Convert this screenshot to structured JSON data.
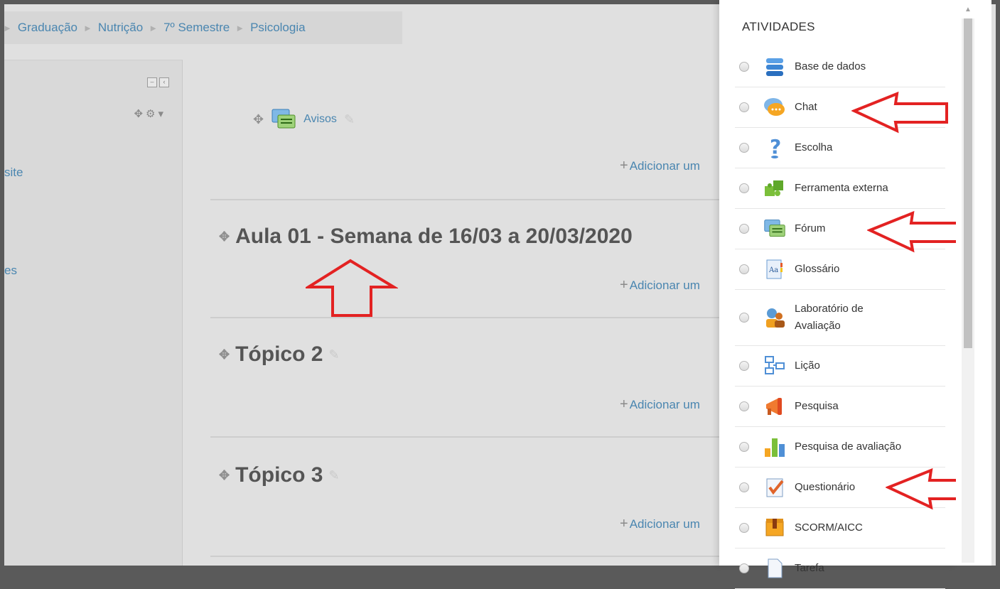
{
  "breadcrumb": {
    "items": [
      "Graduação",
      "Nutrição",
      "7º Semestre",
      "Psicologia"
    ]
  },
  "leftblock": {
    "links": [
      "site",
      "es"
    ]
  },
  "main": {
    "avisos_label": "Avisos",
    "add_label": "Adicionar um",
    "sections": [
      {
        "title": "Aula 01 - Semana de 16/03 a 20/03/2020"
      },
      {
        "title": "Tópico 2"
      },
      {
        "title": "Tópico 3"
      }
    ]
  },
  "panel": {
    "heading": "ATIVIDADES",
    "activities": [
      {
        "label": "Base de dados",
        "icon": "database-icon"
      },
      {
        "label": "Chat",
        "icon": "chat-icon"
      },
      {
        "label": "Escolha",
        "icon": "question-icon"
      },
      {
        "label": "Ferramenta externa",
        "icon": "puzzle-icon"
      },
      {
        "label": "Fórum",
        "icon": "forum-icon"
      },
      {
        "label": "Glossário",
        "icon": "glossary-icon"
      },
      {
        "label": "Laboratório de Avaliação",
        "icon": "workshop-icon"
      },
      {
        "label": "Lição",
        "icon": "lesson-icon"
      },
      {
        "label": "Pesquisa",
        "icon": "megaphone-icon"
      },
      {
        "label": "Pesquisa de avaliação",
        "icon": "bar-chart-icon"
      },
      {
        "label": "Questionário",
        "icon": "quiz-icon"
      },
      {
        "label": "SCORM/AICC",
        "icon": "scorm-package-icon"
      },
      {
        "label": "Tarefa",
        "icon": "assignment-icon"
      }
    ]
  },
  "colors": {
    "link": "#4a86b0",
    "annotation": "#e32222"
  }
}
